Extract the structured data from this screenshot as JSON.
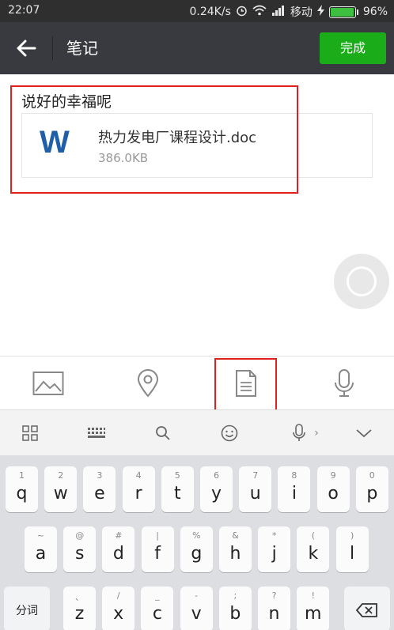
{
  "status_bar": {
    "time": "22:07",
    "net_speed": "0.24K/s",
    "carrier": "移动",
    "battery": "96%"
  },
  "title_bar": {
    "title": "笔记",
    "done_label": "完成"
  },
  "note": {
    "text": "说好的幸福呢",
    "file": {
      "icon_letter": "W",
      "name": "热力发电厂课程设计.doc",
      "size": "386.0KB"
    }
  },
  "attach_bar": {
    "items": [
      "image-icon",
      "location-icon",
      "file-icon",
      "microphone-icon"
    ]
  },
  "keyboard_toolbar": {
    "items": [
      "grid-icon",
      "keyboard-icon",
      "search-icon",
      "emoji-icon",
      "voice-icon",
      "collapse-icon"
    ],
    "voice_arrow": "›"
  },
  "keyboard": {
    "row1": [
      {
        "main": "q",
        "sub": "1"
      },
      {
        "main": "w",
        "sub": "2"
      },
      {
        "main": "e",
        "sub": "3"
      },
      {
        "main": "r",
        "sub": "4"
      },
      {
        "main": "t",
        "sub": "5"
      },
      {
        "main": "y",
        "sub": "6"
      },
      {
        "main": "u",
        "sub": "7"
      },
      {
        "main": "i",
        "sub": "8"
      },
      {
        "main": "o",
        "sub": "9"
      },
      {
        "main": "p",
        "sub": "0"
      }
    ],
    "row2": [
      {
        "main": "a",
        "sub": "~"
      },
      {
        "main": "s",
        "sub": "@"
      },
      {
        "main": "d",
        "sub": "#"
      },
      {
        "main": "f",
        "sub": "|"
      },
      {
        "main": "g",
        "sub": "%"
      },
      {
        "main": "h",
        "sub": "&"
      },
      {
        "main": "j",
        "sub": "*"
      },
      {
        "main": "k",
        "sub": "("
      },
      {
        "main": "l",
        "sub": ")"
      }
    ],
    "row3": [
      {
        "main": "z",
        "sub": "、"
      },
      {
        "main": "x",
        "sub": "/"
      },
      {
        "main": "c",
        "sub": "_"
      },
      {
        "main": "v",
        "sub": "-"
      },
      {
        "main": "b",
        "sub": ";"
      },
      {
        "main": "n",
        "sub": "?"
      },
      {
        "main": "m",
        "sub": "!"
      }
    ],
    "shift_label": "分词",
    "delete_icon": "backspace-icon"
  },
  "colors": {
    "accent_green": "#1aad19",
    "highlight_red": "#e0201f",
    "title_bar_bg": "#393a3f",
    "word_blue": "#1f5fa8"
  }
}
